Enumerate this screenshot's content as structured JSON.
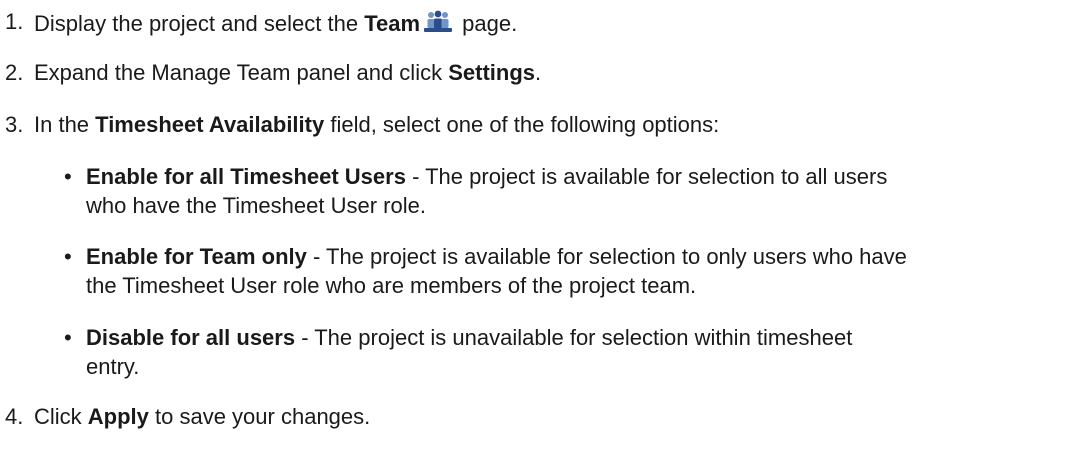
{
  "icons": {
    "team": "team-icon"
  },
  "colors": {
    "team_icon_blue": "#2b4d8c",
    "team_icon_light": "#6f95c9"
  },
  "steps": [
    {
      "number": "1.",
      "pre": "Display the project and select the ",
      "bold": "Team",
      "post": " page."
    },
    {
      "number": "2.",
      "pre": "Expand the Manage Team panel and click ",
      "bold": "Settings",
      "post": "."
    },
    {
      "number": "3.",
      "pre": "In the ",
      "bold": "Timesheet Availability",
      "post": " field, select one of the following options:"
    },
    {
      "number": "4.",
      "pre": "Click ",
      "bold": "Apply",
      "post": " to save your changes."
    }
  ],
  "options": [
    {
      "bold": "Enable for all Timesheet Users",
      "line1": " - The project is available for selection to all users",
      "line2": "who have the Timesheet User role."
    },
    {
      "bold": "Enable for Team only",
      "line1": " - The project is available for selection to only users who have",
      "line2": "the Timesheet User role who are members of the project team."
    },
    {
      "bold": "Disable for all users",
      "line1": " - The project is unavailable for selection within timesheet",
      "line2": "entry."
    }
  ]
}
